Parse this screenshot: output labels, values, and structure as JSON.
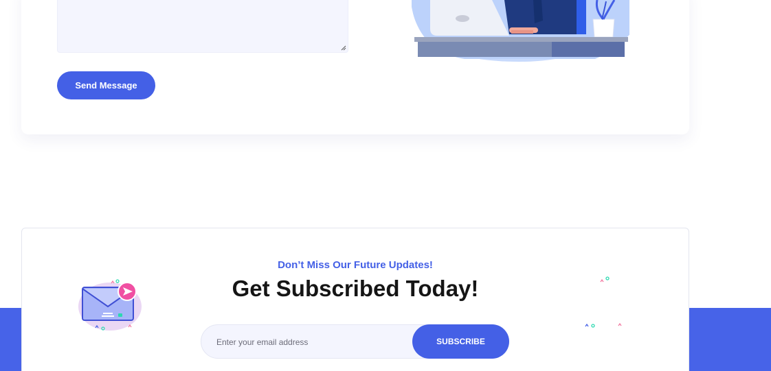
{
  "contact_form": {
    "message_value": "",
    "send_label": "Send Message"
  },
  "subscribe": {
    "tagline": "Don’t Miss Our Future Updates!",
    "headline": "Get Subscribed Today!",
    "email_placeholder": "Enter your email address",
    "button_label": "SUBSCRIBE"
  },
  "icons": {
    "envelope": "envelope-icon",
    "send_badge": "send-arrow-icon",
    "illustration": "person-at-desk-illustration",
    "confetti": "confetti-decoration"
  },
  "colors": {
    "accent": "#4460e6",
    "band": "#4763e8",
    "field_bg": "#f4f5fe",
    "headline": "#151515"
  }
}
